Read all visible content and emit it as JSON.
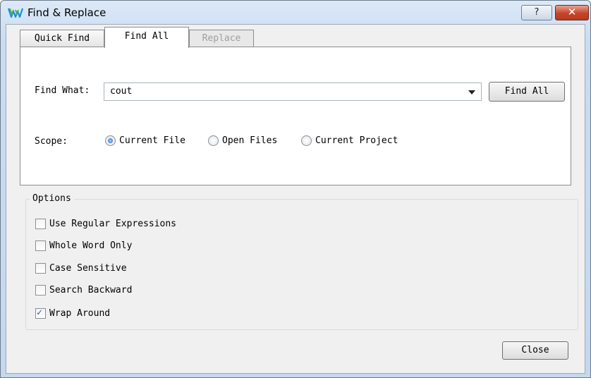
{
  "window": {
    "title": "Find & Replace",
    "help_label": "?",
    "close_label": "✕"
  },
  "tabs": [
    {
      "label": "Quick Find",
      "state": "normal"
    },
    {
      "label": "Find All",
      "state": "selected"
    },
    {
      "label": "Replace",
      "state": "disabled"
    }
  ],
  "find": {
    "label": "Find What:",
    "value": "cout",
    "button_label": "Find All"
  },
  "scope": {
    "label": "Scope:",
    "options": [
      {
        "label": "Current File",
        "selected": true
      },
      {
        "label": "Open Files",
        "selected": false
      },
      {
        "label": "Current Project",
        "selected": false
      }
    ]
  },
  "options": {
    "title": "Options",
    "items": [
      {
        "label": "Use Regular Expressions",
        "checked": false
      },
      {
        "label": "Whole Word Only",
        "checked": false
      },
      {
        "label": "Case Sensitive",
        "checked": false
      },
      {
        "label": "Search Backward",
        "checked": false
      },
      {
        "label": "Wrap Around",
        "checked": true
      }
    ]
  },
  "footer": {
    "close_label": "Close"
  },
  "colors": {
    "title_gradient_top": "#dce9f7",
    "close_button_red": "#c4442a",
    "radio_selected_blue": "#1a63c9",
    "checkmark_blue": "#2a52a8"
  }
}
